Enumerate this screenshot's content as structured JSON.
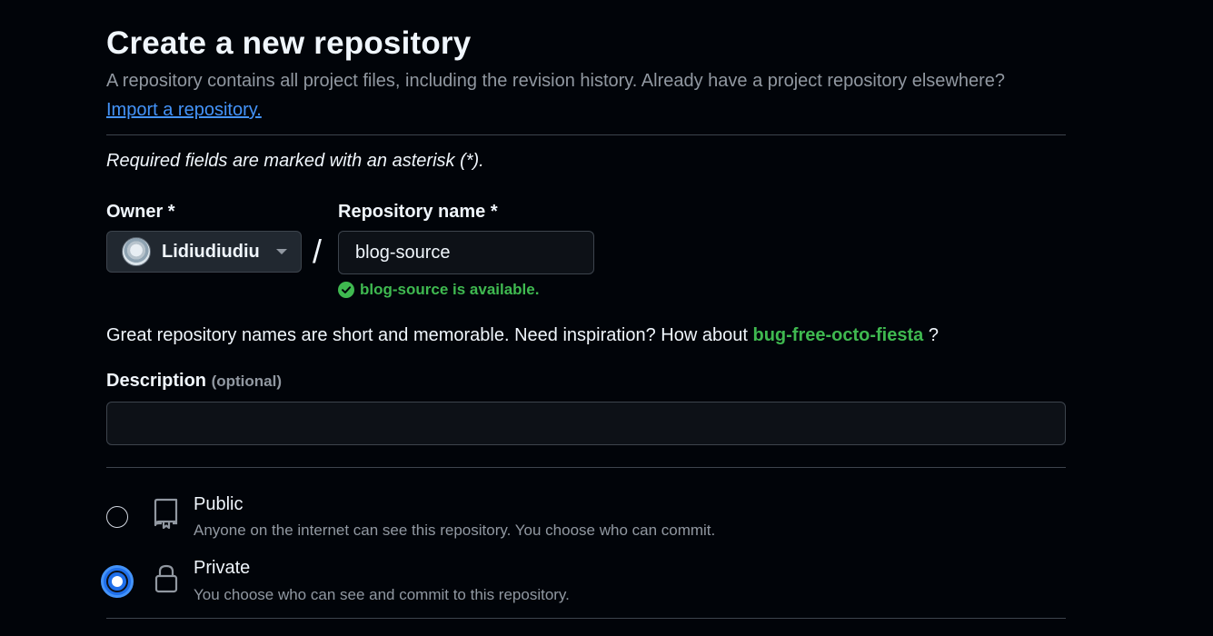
{
  "header": {
    "title": "Create a new repository",
    "subtitle": "A repository contains all project files, including the revision history. Already have a project repository elsewhere?",
    "import_link": "Import a repository."
  },
  "form": {
    "required_note": "Required fields are marked with an asterisk (*).",
    "owner": {
      "label": "Owner *",
      "value": "Lidiudiudiu",
      "icon": "chevron-down-icon"
    },
    "separator": "/",
    "repo_name": {
      "label": "Repository name *",
      "value": "blog-source",
      "availability": "blog-source is available.",
      "availability_icon": "check-circle-icon",
      "availability_color": "#3fb950"
    },
    "suggestion": {
      "prefix": "Great repository names are short and memorable. Need inspiration? How about",
      "name": "bug-free-octo-fiesta",
      "suffix": "?"
    },
    "description": {
      "label": "Description",
      "optional": "(optional)",
      "value": "",
      "placeholder": ""
    },
    "visibility": [
      {
        "title": "Public",
        "description": "Anyone on the internet can see this repository. You choose who can commit.",
        "icon": "repo-icon",
        "selected": false
      },
      {
        "title": "Private",
        "description": "You choose who can see and commit to this repository.",
        "icon": "lock-icon",
        "selected": true
      }
    ]
  },
  "colors": {
    "background": "#010409",
    "link": "#4493f8",
    "success": "#3fb950",
    "accent": "#1f6feb"
  }
}
